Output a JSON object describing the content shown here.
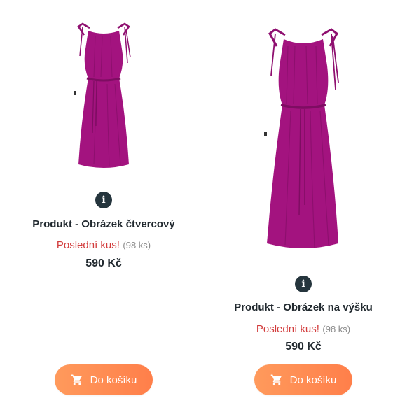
{
  "products": [
    {
      "name": "Produkt - Obrázek čtvercový",
      "stock_label": "Poslední kus!",
      "stock_count": "(98 ks)",
      "price": "590 Kč",
      "button_label": "Do košíku",
      "image_icon": "magenta-dress-image"
    },
    {
      "name": "Produkt - Obrázek na výšku",
      "stock_label": "Poslední kus!",
      "stock_count": "(98 ks)",
      "price": "590 Kč",
      "button_label": "Do košíku",
      "image_icon": "magenta-dress-image"
    }
  ],
  "icons": {
    "info": "info-icon",
    "cart": "cart-icon",
    "info_glyph": "i"
  },
  "colors": {
    "dress": "#a3137f",
    "dress_shadow": "#7e0d62",
    "stock_label": "#d23b3b",
    "button_start": "#ff9a5c",
    "button_end": "#ff7f4a",
    "info_bg": "#25353d"
  }
}
